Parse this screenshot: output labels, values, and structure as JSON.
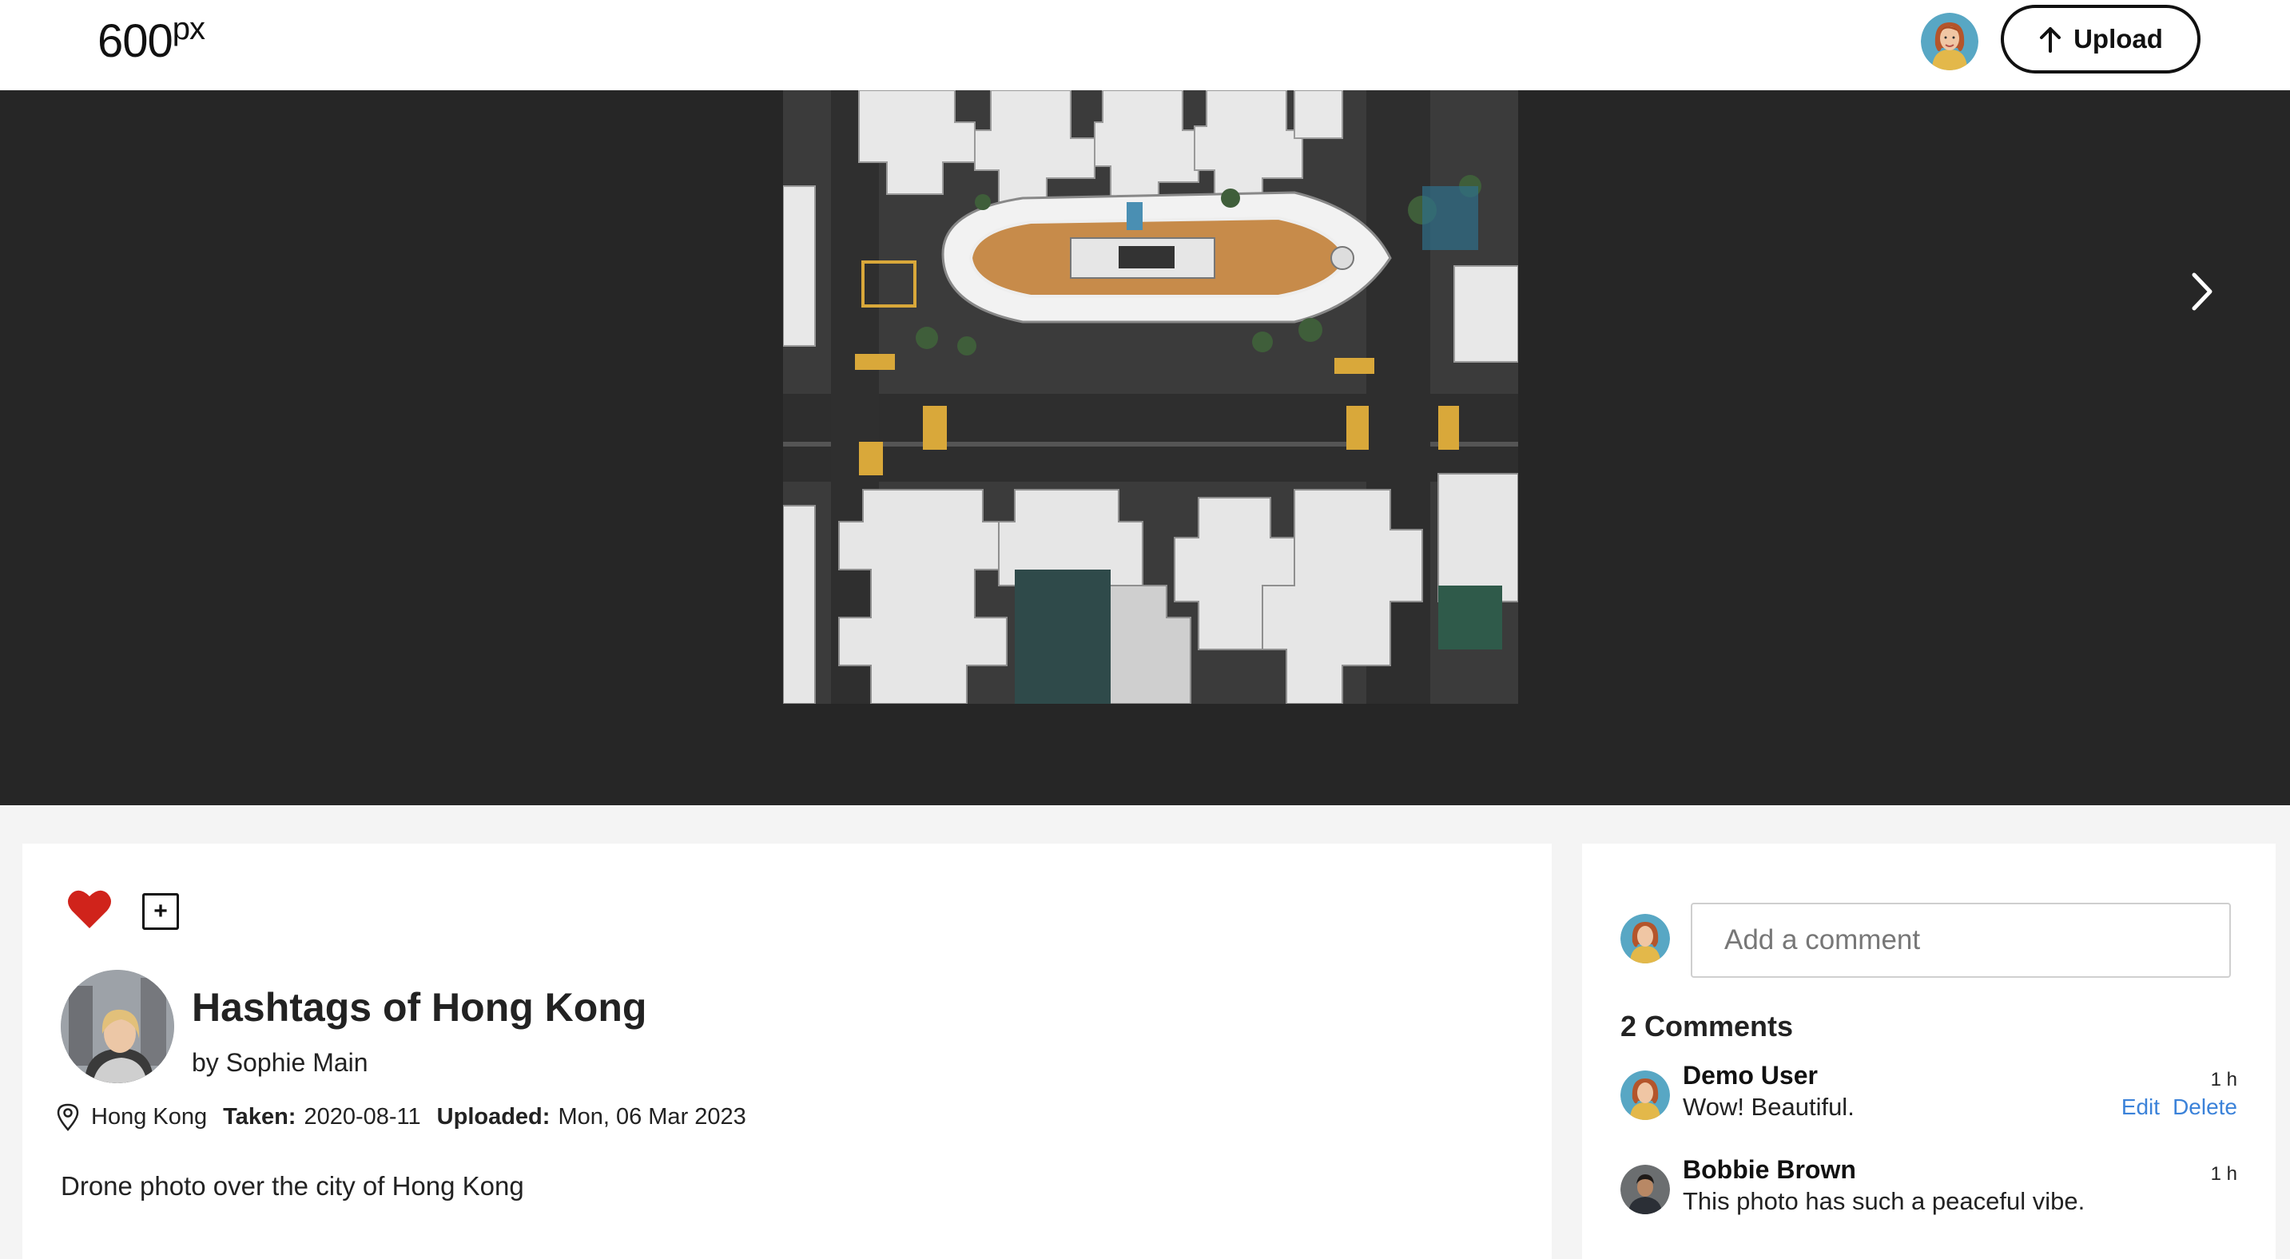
{
  "header": {
    "logo_main": "600",
    "logo_sup": "px",
    "upload_label": "Upload"
  },
  "viewer": {
    "next_icon": "chevron-right-icon"
  },
  "photo": {
    "title": "Hashtags of Hong Kong",
    "by_prefix": "by",
    "author": "Sophie Main",
    "location": "Hong Kong",
    "taken_label": "Taken:",
    "taken_date": "2020-08-11",
    "uploaded_label": "Uploaded:",
    "uploaded_date": "Mon, 06 Mar 2023",
    "description": "Drone photo over the city of Hong Kong",
    "like_icon": "heart-icon",
    "add_icon": "plus-square-icon",
    "add_symbol": "+"
  },
  "comments": {
    "input_placeholder": "Add a comment",
    "count_label": "2 Comments",
    "items": [
      {
        "author": "Demo User",
        "text": "Wow! Beautiful.",
        "time": "1 h",
        "edit_label": "Edit",
        "delete_label": "Delete"
      },
      {
        "author": "Bobbie Brown",
        "text": "This photo has such a peaceful vibe.",
        "time": "1 h"
      }
    ]
  },
  "colors": {
    "heart": "#d0231b",
    "link": "#3b82d9",
    "viewer_bg": "#262626"
  }
}
